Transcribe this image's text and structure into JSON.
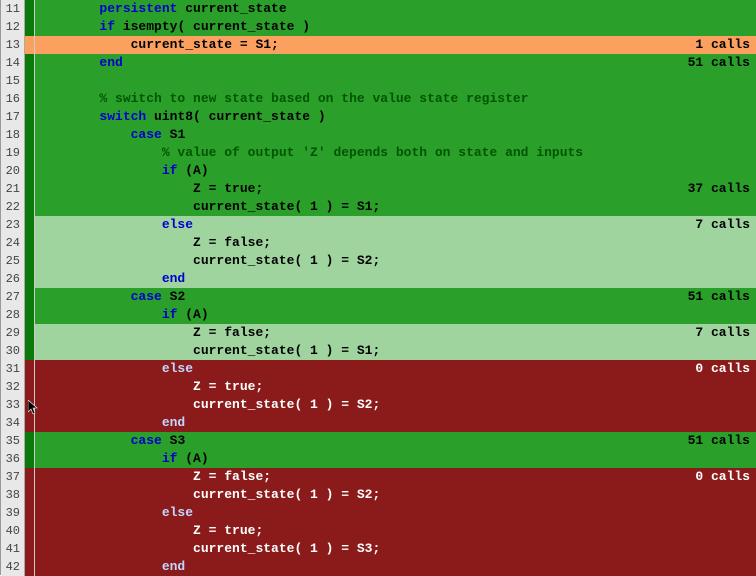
{
  "lines": [
    {
      "n": 11,
      "marker": "green",
      "bg": "bg-green",
      "indent": 8,
      "tokens": [
        [
          "kw",
          "persistent"
        ],
        [
          "",
          " current_state"
        ]
      ],
      "calls": ""
    },
    {
      "n": 12,
      "marker": "green",
      "bg": "bg-green",
      "indent": 8,
      "tokens": [
        [
          "kw",
          "if"
        ],
        [
          "",
          " isempty( current_state )"
        ]
      ],
      "calls": ""
    },
    {
      "n": 13,
      "marker": "hl",
      "bg": "bg-hl",
      "indent": 12,
      "tokens": [
        [
          "",
          "current_state = S1;"
        ]
      ],
      "calls": "1 calls"
    },
    {
      "n": 14,
      "marker": "green",
      "bg": "bg-green",
      "indent": 8,
      "tokens": [
        [
          "kw",
          "end"
        ]
      ],
      "calls": "51 calls"
    },
    {
      "n": 15,
      "marker": "green",
      "bg": "bg-green",
      "indent": 0,
      "tokens": [
        [
          "",
          ""
        ]
      ],
      "calls": ""
    },
    {
      "n": 16,
      "marker": "green",
      "bg": "bg-green",
      "indent": 8,
      "tokens": [
        [
          "cm",
          "% switch to new state based on the value state register"
        ]
      ],
      "calls": ""
    },
    {
      "n": 17,
      "marker": "green",
      "bg": "bg-green",
      "indent": 8,
      "tokens": [
        [
          "kw",
          "switch"
        ],
        [
          "",
          " uint8( current_state )"
        ]
      ],
      "calls": ""
    },
    {
      "n": 18,
      "marker": "green",
      "bg": "bg-green",
      "indent": 12,
      "tokens": [
        [
          "kw",
          "case "
        ],
        [
          "",
          "S1"
        ]
      ],
      "calls": ""
    },
    {
      "n": 19,
      "marker": "green",
      "bg": "bg-green",
      "indent": 16,
      "tokens": [
        [
          "cm",
          "% value of output 'Z' depends both on state and inputs"
        ]
      ],
      "calls": ""
    },
    {
      "n": 20,
      "marker": "green",
      "bg": "bg-green",
      "indent": 16,
      "tokens": [
        [
          "kw",
          "if "
        ],
        [
          "",
          "(A)"
        ]
      ],
      "calls": ""
    },
    {
      "n": 21,
      "marker": "green",
      "bg": "bg-green",
      "indent": 20,
      "tokens": [
        [
          "",
          "Z = true;"
        ]
      ],
      "calls": "37 calls"
    },
    {
      "n": 22,
      "marker": "green",
      "bg": "bg-green",
      "indent": 20,
      "tokens": [
        [
          "",
          "current_state( 1 ) = S1;"
        ]
      ],
      "calls": ""
    },
    {
      "n": 23,
      "marker": "green",
      "bg": "bg-lgreen",
      "indent": 16,
      "tokens": [
        [
          "kw",
          "else"
        ]
      ],
      "calls": "7 calls"
    },
    {
      "n": 24,
      "marker": "green",
      "bg": "bg-lgreen",
      "indent": 20,
      "tokens": [
        [
          "",
          "Z = false;"
        ]
      ],
      "calls": ""
    },
    {
      "n": 25,
      "marker": "green",
      "bg": "bg-lgreen",
      "indent": 20,
      "tokens": [
        [
          "",
          "current_state( 1 ) = S2;"
        ]
      ],
      "calls": ""
    },
    {
      "n": 26,
      "marker": "green",
      "bg": "bg-lgreen",
      "indent": 16,
      "tokens": [
        [
          "kw",
          "end"
        ]
      ],
      "calls": ""
    },
    {
      "n": 27,
      "marker": "green",
      "bg": "bg-green",
      "indent": 12,
      "tokens": [
        [
          "kw",
          "case "
        ],
        [
          "",
          "S2"
        ]
      ],
      "calls": "51 calls"
    },
    {
      "n": 28,
      "marker": "green",
      "bg": "bg-green",
      "indent": 16,
      "tokens": [
        [
          "kw",
          "if "
        ],
        [
          "",
          "(A)"
        ]
      ],
      "calls": ""
    },
    {
      "n": 29,
      "marker": "green",
      "bg": "bg-lgreen",
      "indent": 20,
      "tokens": [
        [
          "",
          "Z = false;"
        ]
      ],
      "calls": "7 calls"
    },
    {
      "n": 30,
      "marker": "green",
      "bg": "bg-lgreen",
      "indent": 20,
      "tokens": [
        [
          "",
          "current_state( 1 ) = S1;"
        ]
      ],
      "calls": ""
    },
    {
      "n": 31,
      "marker": "red",
      "bg": "bg-red",
      "indent": 16,
      "tokens": [
        [
          "kw",
          "else"
        ]
      ],
      "calls": "0 calls"
    },
    {
      "n": 32,
      "marker": "red",
      "bg": "bg-red",
      "indent": 20,
      "tokens": [
        [
          "",
          "Z = true;"
        ]
      ],
      "calls": ""
    },
    {
      "n": 33,
      "marker": "red",
      "bg": "bg-red",
      "indent": 20,
      "tokens": [
        [
          "",
          "current_state( 1 ) = S2;"
        ]
      ],
      "calls": ""
    },
    {
      "n": 34,
      "marker": "red",
      "bg": "bg-red",
      "indent": 16,
      "tokens": [
        [
          "kw",
          "end"
        ]
      ],
      "calls": ""
    },
    {
      "n": 35,
      "marker": "green",
      "bg": "bg-green",
      "indent": 12,
      "tokens": [
        [
          "kw",
          "case "
        ],
        [
          "",
          "S3"
        ]
      ],
      "calls": "51 calls"
    },
    {
      "n": 36,
      "marker": "green",
      "bg": "bg-green",
      "indent": 16,
      "tokens": [
        [
          "kw",
          "if "
        ],
        [
          "",
          "(A)"
        ]
      ],
      "calls": ""
    },
    {
      "n": 37,
      "marker": "red",
      "bg": "bg-red",
      "indent": 20,
      "tokens": [
        [
          "",
          "Z = false;"
        ]
      ],
      "calls": "0 calls"
    },
    {
      "n": 38,
      "marker": "red",
      "bg": "bg-red",
      "indent": 20,
      "tokens": [
        [
          "",
          "current_state( 1 ) = S2;"
        ]
      ],
      "calls": ""
    },
    {
      "n": 39,
      "marker": "red",
      "bg": "bg-red",
      "indent": 16,
      "tokens": [
        [
          "kw",
          "else"
        ]
      ],
      "calls": ""
    },
    {
      "n": 40,
      "marker": "red",
      "bg": "bg-red",
      "indent": 20,
      "tokens": [
        [
          "",
          "Z = true;"
        ]
      ],
      "calls": ""
    },
    {
      "n": 41,
      "marker": "red",
      "bg": "bg-red",
      "indent": 20,
      "tokens": [
        [
          "",
          "current_state( 1 ) = S3;"
        ]
      ],
      "calls": ""
    },
    {
      "n": 42,
      "marker": "red",
      "bg": "bg-red",
      "indent": 16,
      "tokens": [
        [
          "kw",
          "end"
        ]
      ],
      "calls": ""
    }
  ]
}
